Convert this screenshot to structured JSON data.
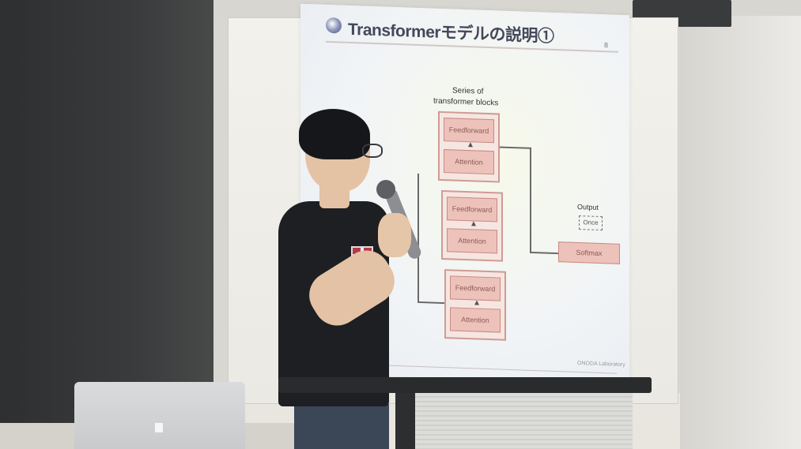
{
  "slide": {
    "title": "Transformerモデルの説明①",
    "page_number": "8",
    "caption_line_1": "Series of",
    "caption_line_2": "transformer blocks",
    "blocks": {
      "top": [
        "Feedforward",
        "Attention"
      ],
      "middle": [
        "Feedforward",
        "Attention"
      ],
      "bottom": [
        "Feedforward",
        "Attention"
      ]
    },
    "output_label": "Output",
    "output_box": "Once",
    "softmax": "Softmax",
    "footer": "ONODA Laboratory"
  }
}
